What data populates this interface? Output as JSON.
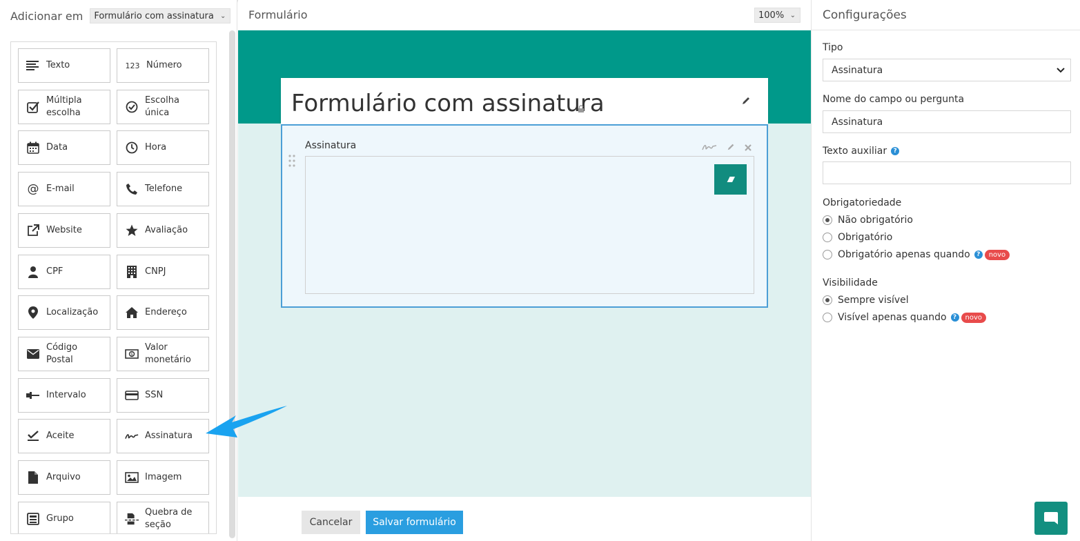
{
  "left_panel": {
    "add_in_label": "Adicionar em",
    "form_select_value": "Formulário com assinatura",
    "items": [
      {
        "label": "Texto",
        "icon": "text-align-icon"
      },
      {
        "label": "Número",
        "icon": "number-icon",
        "icon_text": "123"
      },
      {
        "label": "Múltipla escolha",
        "icon": "checkbox-icon"
      },
      {
        "label": "Escolha única",
        "icon": "check-circle-icon"
      },
      {
        "label": "Data",
        "icon": "calendar-icon"
      },
      {
        "label": "Hora",
        "icon": "clock-icon"
      },
      {
        "label": "E-mail",
        "icon": "at-icon",
        "icon_text": "@"
      },
      {
        "label": "Telefone",
        "icon": "phone-icon"
      },
      {
        "label": "Website",
        "icon": "external-link-icon"
      },
      {
        "label": "Avaliação",
        "icon": "star-icon"
      },
      {
        "label": "CPF",
        "icon": "user-icon"
      },
      {
        "label": "CNPJ",
        "icon": "building-icon"
      },
      {
        "label": "Localização",
        "icon": "map-pin-icon"
      },
      {
        "label": "Endereço",
        "icon": "home-icon"
      },
      {
        "label": "Código Postal",
        "icon": "envelope-icon"
      },
      {
        "label": "Valor monetário",
        "icon": "money-icon"
      },
      {
        "label": "Intervalo",
        "icon": "range-icon"
      },
      {
        "label": "SSN",
        "icon": "card-icon"
      },
      {
        "label": "Aceite",
        "icon": "check-mark-icon"
      },
      {
        "label": "Assinatura",
        "icon": "signature-icon"
      },
      {
        "label": "Arquivo",
        "icon": "file-icon"
      },
      {
        "label": "Imagem",
        "icon": "image-icon"
      },
      {
        "label": "Grupo",
        "icon": "group-icon"
      },
      {
        "label": "Quebra de seção",
        "icon": "section-break-icon"
      }
    ]
  },
  "center": {
    "title": "Formulário",
    "zoom": "100%",
    "form_title": "Formulário com assinatura",
    "field_label": "Assinatura",
    "cancel_label": "Cancelar",
    "save_label": "Salvar formulário"
  },
  "right_panel": {
    "title": "Configurações",
    "type_label": "Tipo",
    "type_value": "Assinatura",
    "name_label": "Nome do campo ou pergunta",
    "name_value": "Assinatura",
    "helper_label": "Texto auxiliar",
    "helper_value": "",
    "required_label": "Obrigatoriedade",
    "required_options": [
      "Não obrigatório",
      "Obrigatório",
      "Obrigatório apenas quando"
    ],
    "required_selected": 0,
    "visibility_label": "Visibilidade",
    "visibility_options": [
      "Sempre visível",
      "Visível apenas quando"
    ],
    "visibility_selected": 0,
    "new_badge": "novo"
  },
  "colors": {
    "brand_teal": "#00998a",
    "canvas_bg": "#dff1f0",
    "selected_border": "#4b9ed6",
    "primary_button": "#2a9ee0",
    "badge_red": "#e84b4b",
    "arrow_blue": "#1aa3f0"
  }
}
